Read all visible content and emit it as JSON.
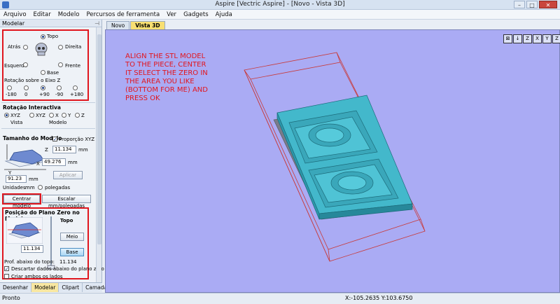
{
  "window": {
    "title": "Aspire [Vectric Aspire] - [Novo - Vista 3D]"
  },
  "menu": [
    "Arquivo",
    "Editar",
    "Modelo",
    "Percursos de ferramenta",
    "Ver",
    "Gadgets",
    "Ajuda"
  ],
  "panel": {
    "title": "Modelar",
    "orientation": {
      "top": "Topo",
      "back": "Atrás",
      "right": "Direita",
      "left": "Esquerda",
      "front": "Frente",
      "bottom": "Base",
      "rotation_label": "Rotação sobre o Eixo Z",
      "angles": [
        "-180",
        "0",
        "+90",
        "-90",
        "+180"
      ]
    },
    "interactive": {
      "title": "Rotação Interactiva",
      "options": [
        "XYZ",
        "XYZ",
        "X",
        "Y",
        "Z"
      ],
      "view_label": "Vista",
      "model_label": "Modelo"
    },
    "size": {
      "title": "Tamanho do Modelo",
      "proportion": "Proporção XYZ",
      "z_value": "11.134",
      "x_value": "49.276",
      "y_value": "91.23",
      "unit_mm": "mm",
      "axis_z": "Z",
      "axis_x": "X",
      "axis_y": "Y",
      "apply": "Aplicar",
      "units_label": "Unidades",
      "unit_inches": "polegadas",
      "center_button": "Centrar modelo",
      "scale_button": "Escalar mm/polegadas"
    },
    "zero": {
      "title": "Posição do Plano Zero no Modelo",
      "top": "Topo",
      "middle": "Meio",
      "bottom": "Base",
      "value": "11.134",
      "depth_label": "Prof. abaixo do topo:",
      "depth_value": "11.134",
      "discard": "Descartar dados abaixo do plano zero",
      "create": "Criar ambos os lados"
    }
  },
  "bottom_tabs": [
    "Desenhar",
    "Modelar",
    "Clipart",
    "Camadas"
  ],
  "doc_tabs": [
    "Novo",
    "Vista 3D"
  ],
  "viewport": {
    "annotation": "ALIGN THE STL MODEL\nTO THE PIECE, CENTER\nIT SELECT THE ZERO IN\nTHE AREA YOU LIKE\n(BOTTOM FOR ME) AND\nPRESS OK",
    "tools": [
      "⊠",
      "↓",
      "Z",
      "X",
      "Y",
      "Z"
    ],
    "colors": {
      "background": "#aaabf4",
      "box": "#c83a3a",
      "model": "#3ab5c9"
    }
  },
  "status": {
    "left": "Pronto",
    "coords": "X:-105.2635 Y:103.6750"
  }
}
